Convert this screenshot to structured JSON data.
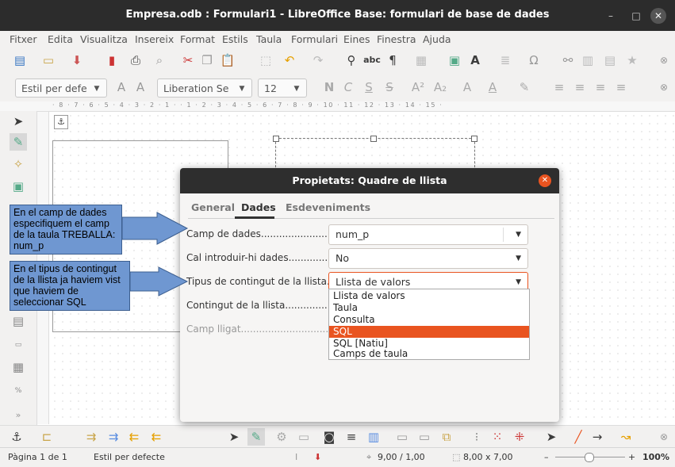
{
  "window": {
    "title": "Empresa.odb : Formulari1 - LibreOffice Base: formulari de base de dades",
    "controls": [
      "minimize-icon",
      "maximize-icon",
      "close-icon"
    ]
  },
  "menu": {
    "items": [
      "Fitxer",
      "Edita",
      "Visualitza",
      "Insereix",
      "Format",
      "Estils",
      "Taula",
      "Formulari",
      "Eines",
      "Finestra",
      "Ajuda"
    ]
  },
  "format_toolbar": {
    "style_value": "Estil per defe",
    "font_value": "Liberation Se",
    "size_value": "12"
  },
  "ruler": {
    "ticks": "· 8 · 7 · 6 · 5 · 4 · 3 · 2 · 1 ·    · 1 · 2 · 3 · 4 · 5 · 6 · 7 · 8 · 9 · 10 · 11 · 12 · 13 · 14 · 15 ·"
  },
  "dialog": {
    "title": "Propietats: Quadre de llista",
    "tabs": [
      "General",
      "Dades",
      "Esdeveniments"
    ],
    "active_tab": "Dades",
    "rows": [
      {
        "label": "Camp de dades............................",
        "value": "num_p"
      },
      {
        "label": "Cal introduir-hi dades.................",
        "value": "No"
      },
      {
        "label": "Tipus de contingut de la llista....",
        "value": "Llista de valors"
      },
      {
        "label": "Contingut de la llista..................",
        "value": ""
      },
      {
        "label": "Camp lligat...................................",
        "value": ""
      }
    ],
    "dropdown_options": [
      "Llista de valors",
      "Taula",
      "Consulta",
      "SQL",
      "SQL [Natiu]",
      "Camps de taula"
    ],
    "dropdown_selected": "SQL"
  },
  "callouts": {
    "first": "En el camp de dades especifiquem el camp de la taula TREBALLA: num_p",
    "second": "En el tipus de contingut de la llista ja haviem vist que haviem de seleccionar  SQL"
  },
  "statusbar": {
    "page": "Pàgina 1 de 1",
    "style": "Estil per defecte",
    "position": "9,00 / 1,00",
    "size": "8,00 x 7,00",
    "zoom": "100%"
  },
  "colors": {
    "accent": "#e95420",
    "titlebar": "#2c2c2c",
    "callout": "#6f97d1"
  }
}
